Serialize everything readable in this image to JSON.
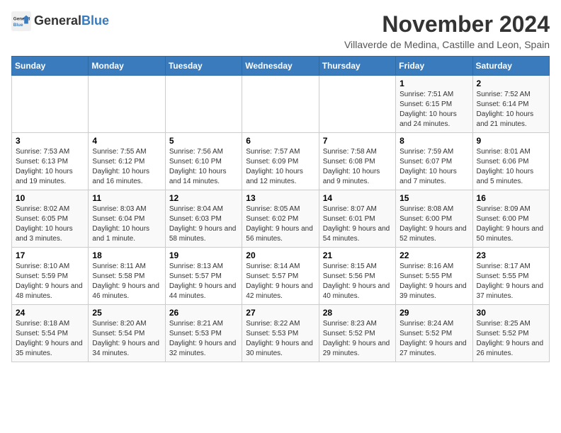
{
  "logo": {
    "general": "General",
    "blue": "Blue"
  },
  "header": {
    "month": "November 2024",
    "location": "Villaverde de Medina, Castille and Leon, Spain"
  },
  "days_of_week": [
    "Sunday",
    "Monday",
    "Tuesday",
    "Wednesday",
    "Thursday",
    "Friday",
    "Saturday"
  ],
  "weeks": [
    [
      {
        "day": "",
        "info": ""
      },
      {
        "day": "",
        "info": ""
      },
      {
        "day": "",
        "info": ""
      },
      {
        "day": "",
        "info": ""
      },
      {
        "day": "",
        "info": ""
      },
      {
        "day": "1",
        "info": "Sunrise: 7:51 AM\nSunset: 6:15 PM\nDaylight: 10 hours and 24 minutes."
      },
      {
        "day": "2",
        "info": "Sunrise: 7:52 AM\nSunset: 6:14 PM\nDaylight: 10 hours and 21 minutes."
      }
    ],
    [
      {
        "day": "3",
        "info": "Sunrise: 7:53 AM\nSunset: 6:13 PM\nDaylight: 10 hours and 19 minutes."
      },
      {
        "day": "4",
        "info": "Sunrise: 7:55 AM\nSunset: 6:12 PM\nDaylight: 10 hours and 16 minutes."
      },
      {
        "day": "5",
        "info": "Sunrise: 7:56 AM\nSunset: 6:10 PM\nDaylight: 10 hours and 14 minutes."
      },
      {
        "day": "6",
        "info": "Sunrise: 7:57 AM\nSunset: 6:09 PM\nDaylight: 10 hours and 12 minutes."
      },
      {
        "day": "7",
        "info": "Sunrise: 7:58 AM\nSunset: 6:08 PM\nDaylight: 10 hours and 9 minutes."
      },
      {
        "day": "8",
        "info": "Sunrise: 7:59 AM\nSunset: 6:07 PM\nDaylight: 10 hours and 7 minutes."
      },
      {
        "day": "9",
        "info": "Sunrise: 8:01 AM\nSunset: 6:06 PM\nDaylight: 10 hours and 5 minutes."
      }
    ],
    [
      {
        "day": "10",
        "info": "Sunrise: 8:02 AM\nSunset: 6:05 PM\nDaylight: 10 hours and 3 minutes."
      },
      {
        "day": "11",
        "info": "Sunrise: 8:03 AM\nSunset: 6:04 PM\nDaylight: 10 hours and 1 minute."
      },
      {
        "day": "12",
        "info": "Sunrise: 8:04 AM\nSunset: 6:03 PM\nDaylight: 9 hours and 58 minutes."
      },
      {
        "day": "13",
        "info": "Sunrise: 8:05 AM\nSunset: 6:02 PM\nDaylight: 9 hours and 56 minutes."
      },
      {
        "day": "14",
        "info": "Sunrise: 8:07 AM\nSunset: 6:01 PM\nDaylight: 9 hours and 54 minutes."
      },
      {
        "day": "15",
        "info": "Sunrise: 8:08 AM\nSunset: 6:00 PM\nDaylight: 9 hours and 52 minutes."
      },
      {
        "day": "16",
        "info": "Sunrise: 8:09 AM\nSunset: 6:00 PM\nDaylight: 9 hours and 50 minutes."
      }
    ],
    [
      {
        "day": "17",
        "info": "Sunrise: 8:10 AM\nSunset: 5:59 PM\nDaylight: 9 hours and 48 minutes."
      },
      {
        "day": "18",
        "info": "Sunrise: 8:11 AM\nSunset: 5:58 PM\nDaylight: 9 hours and 46 minutes."
      },
      {
        "day": "19",
        "info": "Sunrise: 8:13 AM\nSunset: 5:57 PM\nDaylight: 9 hours and 44 minutes."
      },
      {
        "day": "20",
        "info": "Sunrise: 8:14 AM\nSunset: 5:57 PM\nDaylight: 9 hours and 42 minutes."
      },
      {
        "day": "21",
        "info": "Sunrise: 8:15 AM\nSunset: 5:56 PM\nDaylight: 9 hours and 40 minutes."
      },
      {
        "day": "22",
        "info": "Sunrise: 8:16 AM\nSunset: 5:55 PM\nDaylight: 9 hours and 39 minutes."
      },
      {
        "day": "23",
        "info": "Sunrise: 8:17 AM\nSunset: 5:55 PM\nDaylight: 9 hours and 37 minutes."
      }
    ],
    [
      {
        "day": "24",
        "info": "Sunrise: 8:18 AM\nSunset: 5:54 PM\nDaylight: 9 hours and 35 minutes."
      },
      {
        "day": "25",
        "info": "Sunrise: 8:20 AM\nSunset: 5:54 PM\nDaylight: 9 hours and 34 minutes."
      },
      {
        "day": "26",
        "info": "Sunrise: 8:21 AM\nSunset: 5:53 PM\nDaylight: 9 hours and 32 minutes."
      },
      {
        "day": "27",
        "info": "Sunrise: 8:22 AM\nSunset: 5:53 PM\nDaylight: 9 hours and 30 minutes."
      },
      {
        "day": "28",
        "info": "Sunrise: 8:23 AM\nSunset: 5:52 PM\nDaylight: 9 hours and 29 minutes."
      },
      {
        "day": "29",
        "info": "Sunrise: 8:24 AM\nSunset: 5:52 PM\nDaylight: 9 hours and 27 minutes."
      },
      {
        "day": "30",
        "info": "Sunrise: 8:25 AM\nSunset: 5:52 PM\nDaylight: 9 hours and 26 minutes."
      }
    ]
  ]
}
